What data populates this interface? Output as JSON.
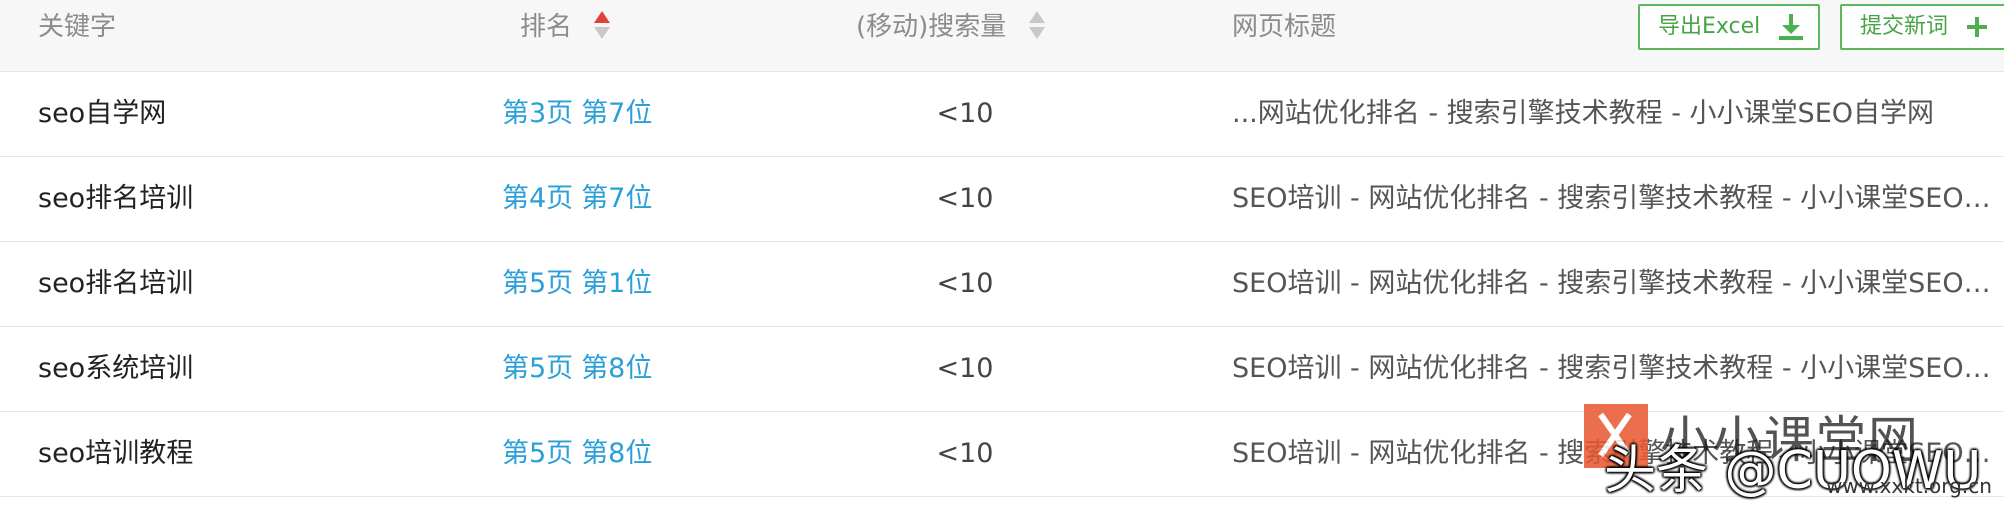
{
  "header": {
    "keyword": "关键字",
    "rank": "排名",
    "volume": "(移动)搜索量",
    "title": "网页标题",
    "export_button": "导出Excel",
    "submit_button": "提交新词"
  },
  "rows": [
    {
      "keyword": "seo自学网",
      "page": "第3页",
      "position": "第7位",
      "volume": "<10",
      "title": "...网站优化排名 - 搜索引擎技术教程 - 小小课堂SEO自学网"
    },
    {
      "keyword": "seo排名培训",
      "page": "第4页",
      "position": "第7位",
      "volume": "<10",
      "title": "SEO培训 - 网站优化排名 - 搜索引擎技术教程 - 小小课堂SEO自学网"
    },
    {
      "keyword": "seo排名培训",
      "page": "第5页",
      "position": "第1位",
      "volume": "<10",
      "title": "SEO培训 - 网站优化排名 - 搜索引擎技术教程 - 小小课堂SEO自学网"
    },
    {
      "keyword": "seo系统培训",
      "page": "第5页",
      "position": "第8位",
      "volume": "<10",
      "title": "SEO培训 - 网站优化排名 - 搜索引擎技术教程 - 小小课堂SEO自学网"
    },
    {
      "keyword": "seo培训教程",
      "page": "第5页",
      "position": "第8位",
      "volume": "<10",
      "title": "SEO培训 - 网站优化排名 - 搜索引擎技术教程 - 小小课堂SEO自学网"
    }
  ],
  "watermark": {
    "site_name": "小小课堂网",
    "author": "头条 @CUOWU",
    "url": "www.xxkt.org.cn"
  },
  "colors": {
    "link": "#2a9fd8",
    "button_green": "#5bb85d",
    "sort_active": "#e0413a",
    "sort_inactive": "#c8c8c8"
  },
  "icons": {
    "export": "download-icon",
    "submit": "plus-icon",
    "rank_sort": "sort-asc-icon",
    "volume_sort": "sort-icon"
  }
}
